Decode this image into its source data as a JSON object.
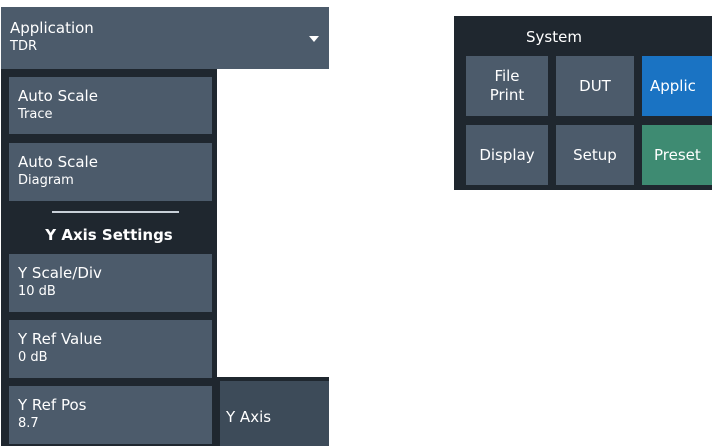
{
  "application_menu": {
    "label": "Application",
    "value": "TDR",
    "icon": "chevron-down-icon"
  },
  "softkeys": {
    "auto_scale_trace": {
      "line1": "Auto Scale",
      "line2": "Trace"
    },
    "auto_scale_diagram": {
      "line1": "Auto Scale",
      "line2": "Diagram"
    },
    "section_title": "Y Axis Settings",
    "y_scale_div": {
      "line1": "Y Scale/Div",
      "line2": "10 dB"
    },
    "y_ref_value": {
      "line1": "Y Ref Value",
      "line2": "0 dB"
    },
    "y_ref_pos": {
      "line1": "Y Ref Pos",
      "line2": "8.7"
    }
  },
  "side_tab": {
    "label": "Y Axis"
  },
  "system_panel": {
    "title": "System",
    "buttons": {
      "file_print": {
        "line1": "File",
        "line2": "Print"
      },
      "dut": "DUT",
      "applic": "Applic",
      "display": "Display",
      "setup": "Setup",
      "preset": "Preset"
    }
  },
  "colors": {
    "button": "#4c5b6b",
    "panel_background": "#1f272f",
    "active_blue": "#1a73c3",
    "preset_green": "#3e8b72"
  }
}
